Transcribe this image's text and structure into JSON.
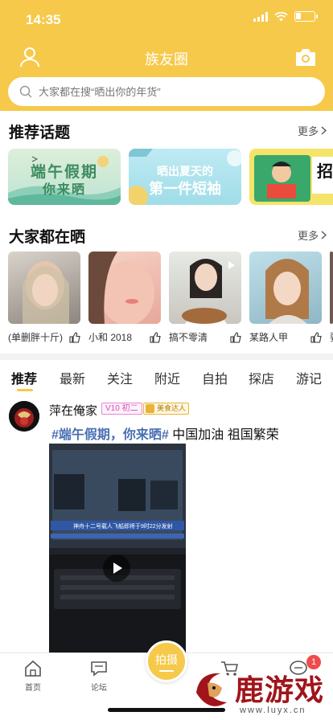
{
  "status_bar": {
    "time": "14:35",
    "battery_level": 0.3
  },
  "header": {
    "title": "族友圈",
    "user_icon": "user-icon",
    "camera_icon": "camera-icon"
  },
  "search": {
    "placeholder": "大家都在搜“晒出你的年货”",
    "icon": "search-icon"
  },
  "topics": {
    "title": "推荐话题",
    "more": "更多",
    "cards": [
      {
        "text_line1": "端午假期",
        "text_line2": "你来晒"
      },
      {
        "text_line1": "晒出夏天的",
        "text_line2": "第一件短袖"
      },
      {
        "text_line1": "招"
      }
    ]
  },
  "sharing": {
    "title": "大家都在晒",
    "more": "更多",
    "items": [
      {
        "name": "(单删胖十斤)"
      },
      {
        "name": "小和 2018"
      },
      {
        "name": "搞不零清"
      },
      {
        "name": "某路人甲"
      },
      {
        "name": "要"
      }
    ]
  },
  "tabs": [
    "推荐",
    "最新",
    "关注",
    "附近",
    "自拍",
    "探店",
    "游记"
  ],
  "active_tab": "推荐",
  "post": {
    "author": "萍在俺家",
    "vip_badge": "V10 初二",
    "food_badge": "美食达人",
    "tag": "#端午假期，你来晒#",
    "text": " 中国加油 祖国繁荣",
    "video_caption": "神舟十二号载人飞船即将于9时22分发射"
  },
  "bottom_nav": {
    "home": "首页",
    "forum": "论坛",
    "shoot": "拍摄",
    "message_count": "1"
  },
  "watermark": {
    "text": "鹿游戏",
    "url": "www.luyx.cn"
  },
  "colors": {
    "brand": "#f6c94a",
    "tag": "#4a6fb3",
    "badge_red": "#f04a4a"
  }
}
